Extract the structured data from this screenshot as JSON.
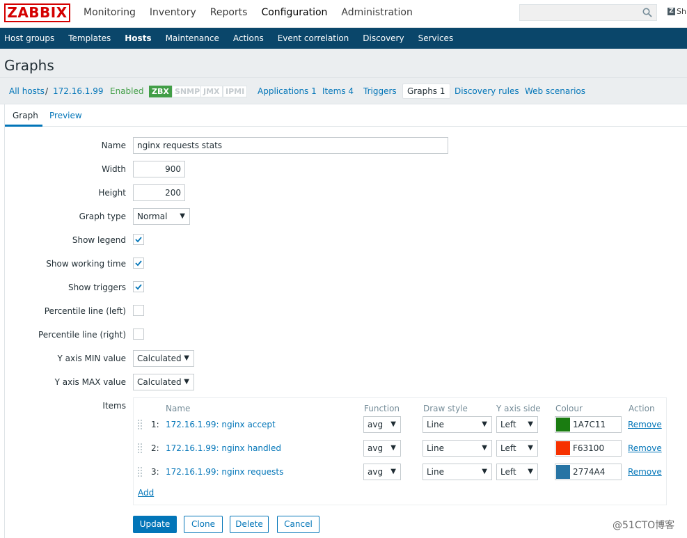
{
  "app": {
    "logo_text": "ZABBIX"
  },
  "main_menu": {
    "items": [
      "Monitoring",
      "Inventory",
      "Reports",
      "Configuration",
      "Administration"
    ],
    "active": "Configuration"
  },
  "search": {
    "placeholder": "",
    "icon": "search-icon"
  },
  "share": {
    "label": "Sh"
  },
  "sub_menu": {
    "items": [
      "Host groups",
      "Templates",
      "Hosts",
      "Maintenance",
      "Actions",
      "Event correlation",
      "Discovery",
      "Services"
    ],
    "active": "Hosts"
  },
  "page": {
    "title": "Graphs"
  },
  "hostbar": {
    "all_hosts": "All hosts",
    "separator": "/",
    "host": "172.16.1.99",
    "status": "Enabled",
    "badges": [
      "ZBX",
      "SNMP",
      "JMX",
      "IPMI"
    ],
    "applications": "Applications 1",
    "items": "Items 4",
    "triggers": "Triggers",
    "graphs": "Graphs 1",
    "discovery_rules": "Discovery rules",
    "web_scenarios": "Web scenarios"
  },
  "tabs": {
    "graph": "Graph",
    "preview": "Preview"
  },
  "form": {
    "name_label": "Name",
    "name_value": "nginx requests stats",
    "width_label": "Width",
    "width_value": "900",
    "height_label": "Height",
    "height_value": "200",
    "graph_type_label": "Graph type",
    "graph_type_value": "Normal",
    "show_legend_label": "Show legend",
    "show_legend": true,
    "show_working_time_label": "Show working time",
    "show_working_time": true,
    "show_triggers_label": "Show triggers",
    "show_triggers": true,
    "percentile_left_label": "Percentile line (left)",
    "percentile_left": false,
    "percentile_right_label": "Percentile line (right)",
    "percentile_right": false,
    "ymin_label": "Y axis MIN value",
    "ymin_value": "Calculated",
    "ymax_label": "Y axis MAX value",
    "ymax_value": "Calculated",
    "items_label": "Items"
  },
  "items_table": {
    "headers": [
      "Name",
      "Function",
      "Draw style",
      "Y axis side",
      "Colour",
      "Action"
    ],
    "rows": [
      {
        "num": "1:",
        "name": "172.16.1.99: nginx accept",
        "function": "avg",
        "draw_style": "Line",
        "y_axis_side": "Left",
        "colour": "1A7C11",
        "colour_hex": "#1A7C11",
        "action": "Remove"
      },
      {
        "num": "2:",
        "name": "172.16.1.99: nginx handled",
        "function": "avg",
        "draw_style": "Line",
        "y_axis_side": "Left",
        "colour": "F63100",
        "colour_hex": "#F63100",
        "action": "Remove"
      },
      {
        "num": "3:",
        "name": "172.16.1.99: nginx requests",
        "function": "avg",
        "draw_style": "Line",
        "y_axis_side": "Left",
        "colour": "2774A4",
        "colour_hex": "#2774A4",
        "action": "Remove"
      }
    ],
    "add_label": "Add"
  },
  "buttons": {
    "update": "Update",
    "clone": "Clone",
    "delete": "Delete",
    "cancel": "Cancel"
  },
  "watermark": "@51CTO博客",
  "colors": {
    "brand": "#d40000",
    "nav": "#0a466a",
    "link": "#0275b8",
    "enabled": "#429e47"
  }
}
